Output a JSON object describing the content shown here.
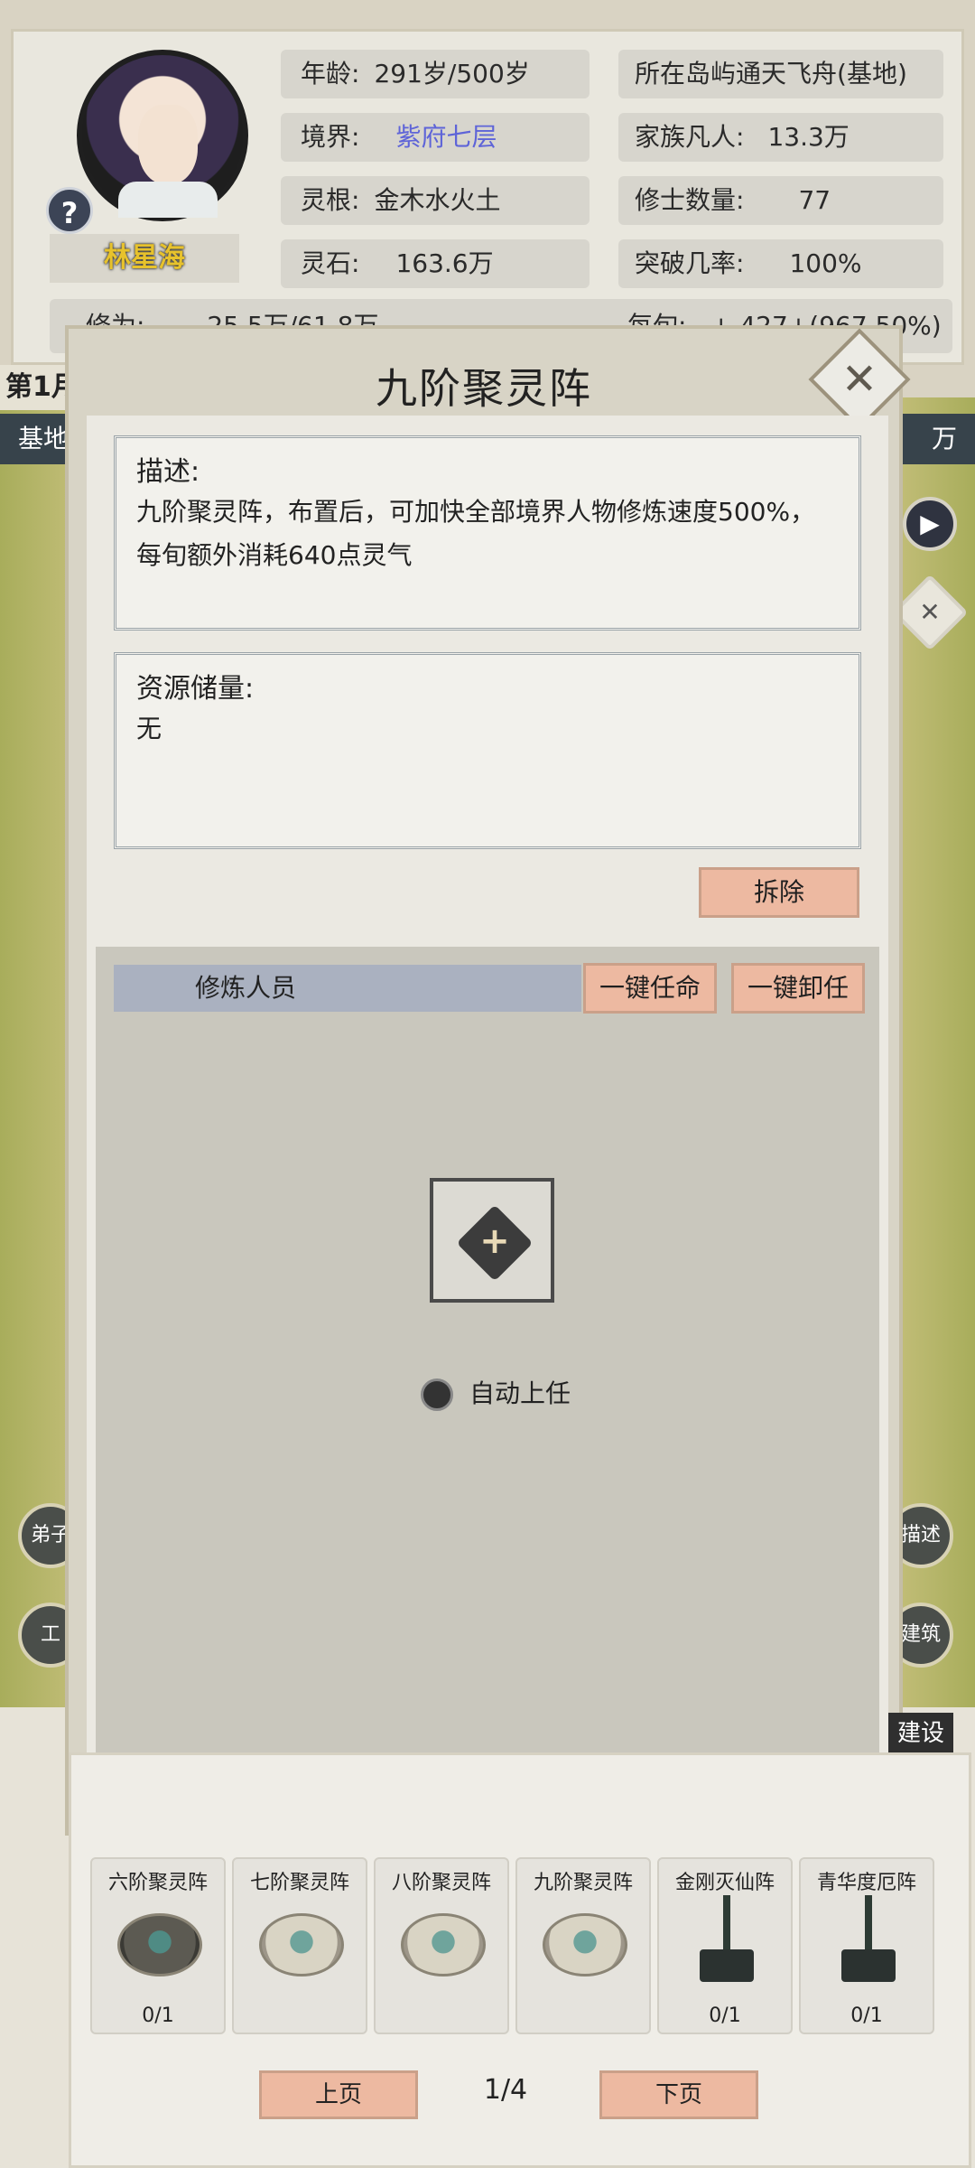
{
  "player": {
    "name": "林星海",
    "age": {
      "label": "年龄:",
      "value": "291岁/500岁"
    },
    "realm": {
      "label": "境界:",
      "value": "紫府七层"
    },
    "spirit_root": {
      "label": "灵根:",
      "value": "金木水火土"
    },
    "spirit_stone": {
      "label": "灵石:",
      "value": "163.6万"
    },
    "cultivation": {
      "label": "修为:",
      "value": "25.5万/61.8万"
    },
    "island": {
      "label": "所在岛屿",
      "value": "通天飞舟(基地)"
    },
    "mortals": {
      "label": "家族凡人:",
      "value": "13.3万"
    },
    "cultivators": {
      "label": "修士数量:",
      "value": "77"
    },
    "breakthrough": {
      "label": "突破几率:",
      "value": "100%"
    },
    "per_turn": {
      "label": "每旬:",
      "value": "+ 427+(967.50%)"
    }
  },
  "hud": {
    "date_fragment": "第1月",
    "strip_left": "基地",
    "strip_right": "万",
    "help_icon": "?",
    "play_icon": "▶",
    "close_map_icon": "✕",
    "left_btn_1": "弟子",
    "left_btn_2": "工",
    "right_btn_1": "描述",
    "right_btn_2": "建筑",
    "tray_tag": "建设"
  },
  "dialog": {
    "title": "九阶聚灵阵",
    "close_icon": "✕",
    "desc_label": "描述:",
    "desc_text": "九阶聚灵阵，布置后，可加快全部境界人物修炼速度500%，每旬额外消耗640点灵气",
    "resource_label": "资源储量:",
    "resource_text": "无",
    "demolish_button": "拆除",
    "crew_header": "修炼人员",
    "appoint_all_button": "一键任命",
    "dismiss_all_button": "一键卸任",
    "add_icon": "+",
    "auto_label": "自动上任"
  },
  "tray": {
    "items": [
      {
        "name": "六阶聚灵阵",
        "count": "0/1"
      },
      {
        "name": "七阶聚灵阵",
        "count": ""
      },
      {
        "name": "八阶聚灵阵",
        "count": ""
      },
      {
        "name": "九阶聚灵阵",
        "count": ""
      },
      {
        "name": "金刚灭仙阵",
        "count": "0/1"
      },
      {
        "name": "青华度厄阵",
        "count": "0/1"
      }
    ],
    "prev_button": "上页",
    "page": "1/4",
    "next_button": "下页"
  }
}
